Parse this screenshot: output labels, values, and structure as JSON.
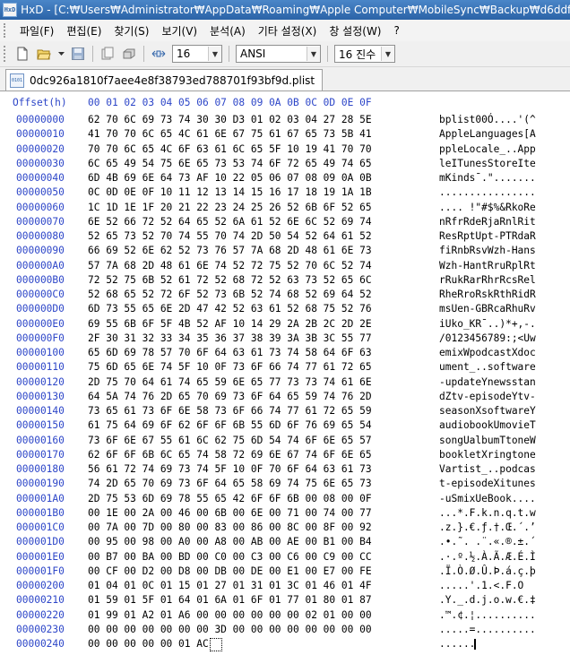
{
  "window": {
    "app_icon": "HxD",
    "title": "HxD - [C:₩Users₩Administrator₩AppData₩Roaming₩Apple Computer₩MobileSync₩Backup₩d6ddf6961c8e45d5"
  },
  "menu": [
    {
      "label": "파일(F)"
    },
    {
      "label": "편집(E)"
    },
    {
      "label": "찾기(S)"
    },
    {
      "label": "보기(V)"
    },
    {
      "label": "분석(A)"
    },
    {
      "label": "기타 설정(X)"
    },
    {
      "label": "창 설정(W)"
    },
    {
      "label": "?"
    }
  ],
  "toolbar": {
    "bytes_per_row": "16",
    "charset": "ANSI",
    "offset_base": "16 진수"
  },
  "tab": {
    "filename": "0dc926a1810f7aee4e8f38793ed788701f93bf9d.plist"
  },
  "hex": {
    "header_offset": "Offset(h)",
    "header_cols": "00 01 02 03 04 05 06 07 08 09 0A 0B 0C 0D 0E 0F",
    "rows": [
      {
        "off": "00000000",
        "hex": "62 70 6C 69 73 74 30 30 D3 01 02 03 04 27 28 5E",
        "asc": "bplist00Ó....'(^"
      },
      {
        "off": "00000010",
        "hex": "41 70 70 6C 65 4C 61 6E 67 75 61 67 65 73 5B 41",
        "asc": "AppleLanguages[A"
      },
      {
        "off": "00000020",
        "hex": "70 70 6C 65 4C 6F 63 61 6C 65 5F 10 19 41 70 70",
        "asc": "ppleLocale_..App"
      },
      {
        "off": "00000030",
        "hex": "6C 65 49 54 75 6E 65 73 53 74 6F 72 65 49 74 65",
        "asc": "leITunesStoreIte"
      },
      {
        "off": "00000040",
        "hex": "6D 4B 69 6E 64 73 AF 10 22 05 06 07 08 09 0A 0B",
        "asc": "mKinds¯.\"......."
      },
      {
        "off": "00000050",
        "hex": "0C 0D 0E 0F 10 11 12 13 14 15 16 17 18 19 1A 1B",
        "asc": "................"
      },
      {
        "off": "00000060",
        "hex": "1C 1D 1E 1F 20 21 22 23 24 25 26 52 6B 6F 52 65",
        "asc": ".... !\"#$%&RkoRe"
      },
      {
        "off": "00000070",
        "hex": "6E 52 66 72 52 64 65 52 6A 61 52 6E 6C 52 69 74",
        "asc": "nRfrRdeRjaRnlRit"
      },
      {
        "off": "00000080",
        "hex": "52 65 73 52 70 74 55 70 74 2D 50 54 52 64 61 52",
        "asc": "ResRptUpt-PTRdaR"
      },
      {
        "off": "00000090",
        "hex": "66 69 52 6E 62 52 73 76 57 7A 68 2D 48 61 6E 73",
        "asc": "fiRnbRsvWzh-Hans"
      },
      {
        "off": "000000A0",
        "hex": "57 7A 68 2D 48 61 6E 74 52 72 75 52 70 6C 52 74",
        "asc": "Wzh-HantRruRplRt"
      },
      {
        "off": "000000B0",
        "hex": "72 52 75 6B 52 61 72 52 68 72 52 63 73 52 65 6C",
        "asc": "rRukRarRhrRcsRel"
      },
      {
        "off": "000000C0",
        "hex": "52 68 65 52 72 6F 52 73 6B 52 74 68 52 69 64 52",
        "asc": "RheRroRskRthRidR"
      },
      {
        "off": "000000D0",
        "hex": "6D 73 55 65 6E 2D 47 42 52 63 61 52 68 75 52 76",
        "asc": "msUen-GBRcaRhuRv"
      },
      {
        "off": "000000E0",
        "hex": "69 55 6B 6F 5F 4B 52 AF 10 14 29 2A 2B 2C 2D 2E",
        "asc": "iUko_KR¯..)*+,-."
      },
      {
        "off": "000000F0",
        "hex": "2F 30 31 32 33 34 35 36 37 38 39 3A 3B 3C 55 77",
        "asc": "/0123456789:;<Uw"
      },
      {
        "off": "00000100",
        "hex": "65 6D 69 78 57 70 6F 64 63 61 73 74 58 64 6F 63",
        "asc": "emixWpodcastXdoc"
      },
      {
        "off": "00000110",
        "hex": "75 6D 65 6E 74 5F 10 0F 73 6F 66 74 77 61 72 65",
        "asc": "ument_..software"
      },
      {
        "off": "00000120",
        "hex": "2D 75 70 64 61 74 65 59 6E 65 77 73 73 74 61 6E",
        "asc": "-updateYnewsstan"
      },
      {
        "off": "00000130",
        "hex": "64 5A 74 76 2D 65 70 69 73 6F 64 65 59 74 76 2D",
        "asc": "dZtv-episodeYtv-"
      },
      {
        "off": "00000140",
        "hex": "73 65 61 73 6F 6E 58 73 6F 66 74 77 61 72 65 59",
        "asc": "seasonXsoftwareY"
      },
      {
        "off": "00000150",
        "hex": "61 75 64 69 6F 62 6F 6F 6B 55 6D 6F 76 69 65 54",
        "asc": "audiobookUmovieT"
      },
      {
        "off": "00000160",
        "hex": "73 6F 6E 67 55 61 6C 62 75 6D 54 74 6F 6E 65 57",
        "asc": "songUalbumTtoneW"
      },
      {
        "off": "00000170",
        "hex": "62 6F 6F 6B 6C 65 74 58 72 69 6E 67 74 6F 6E 65",
        "asc": "bookletXringtone"
      },
      {
        "off": "00000180",
        "hex": "56 61 72 74 69 73 74 5F 10 0F 70 6F 64 63 61 73",
        "asc": "Vartist_..podcas"
      },
      {
        "off": "00000190",
        "hex": "74 2D 65 70 69 73 6F 64 65 58 69 74 75 6E 65 73",
        "asc": "t-episodeXitunes"
      },
      {
        "off": "000001A0",
        "hex": "2D 75 53 6D 69 78 55 65 42 6F 6F 6B 00 08 00 0F",
        "asc": "-uSmixUeBook...."
      },
      {
        "off": "000001B0",
        "hex": "00 1E 00 2A 00 46 00 6B 00 6E 00 71 00 74 00 77",
        "asc": "...*.F.k.n.q.t.w"
      },
      {
        "off": "000001C0",
        "hex": "00 7A 00 7D 00 80 00 83 00 86 00 8C 00 8F 00 92",
        "asc": ".z.}.€.ƒ.†.Œ.´.’"
      },
      {
        "off": "000001D0",
        "hex": "00 95 00 98 00 A0 00 A8 00 AB 00 AE 00 B1 00 B4",
        "asc": ".•.˜. .¨.«.®.±.´"
      },
      {
        "off": "000001E0",
        "hex": "00 B7 00 BA 00 BD 00 C0 00 C3 00 C6 00 C9 00 CC",
        "asc": ".·.º.½.À.Ã.Æ.É.Ì"
      },
      {
        "off": "000001F0",
        "hex": "00 CF 00 D2 00 D8 00 DB 00 DE 00 E1 00 E7 00 FE",
        "asc": ".Ï.Ò.Ø.Û.Þ.á.ç.þ"
      },
      {
        "off": "00000200",
        "hex": "01 04 01 0C 01 15 01 27 01 31 01 3C 01 46 01 4F",
        "asc": ".....'.1.<.F.O"
      },
      {
        "off": "00000210",
        "hex": "01 59 01 5F 01 64 01 6A 01 6F 01 77 01 80 01 87",
        "asc": ".Y._.d.j.o.w.€.‡"
      },
      {
        "off": "00000220",
        "hex": "01 99 01 A2 01 A6 00 00 00 00 00 00 02 01 00 00",
        "asc": ".™.¢.¦.........."
      },
      {
        "off": "00000230",
        "hex": "00 00 00 00 00 00 00 3D 00 00 00 00 00 00 00 00",
        "asc": ".....=.........."
      },
      {
        "off": "00000240",
        "hex": "00 00 00 00 00 01 AC",
        "asc": "......"
      }
    ]
  }
}
